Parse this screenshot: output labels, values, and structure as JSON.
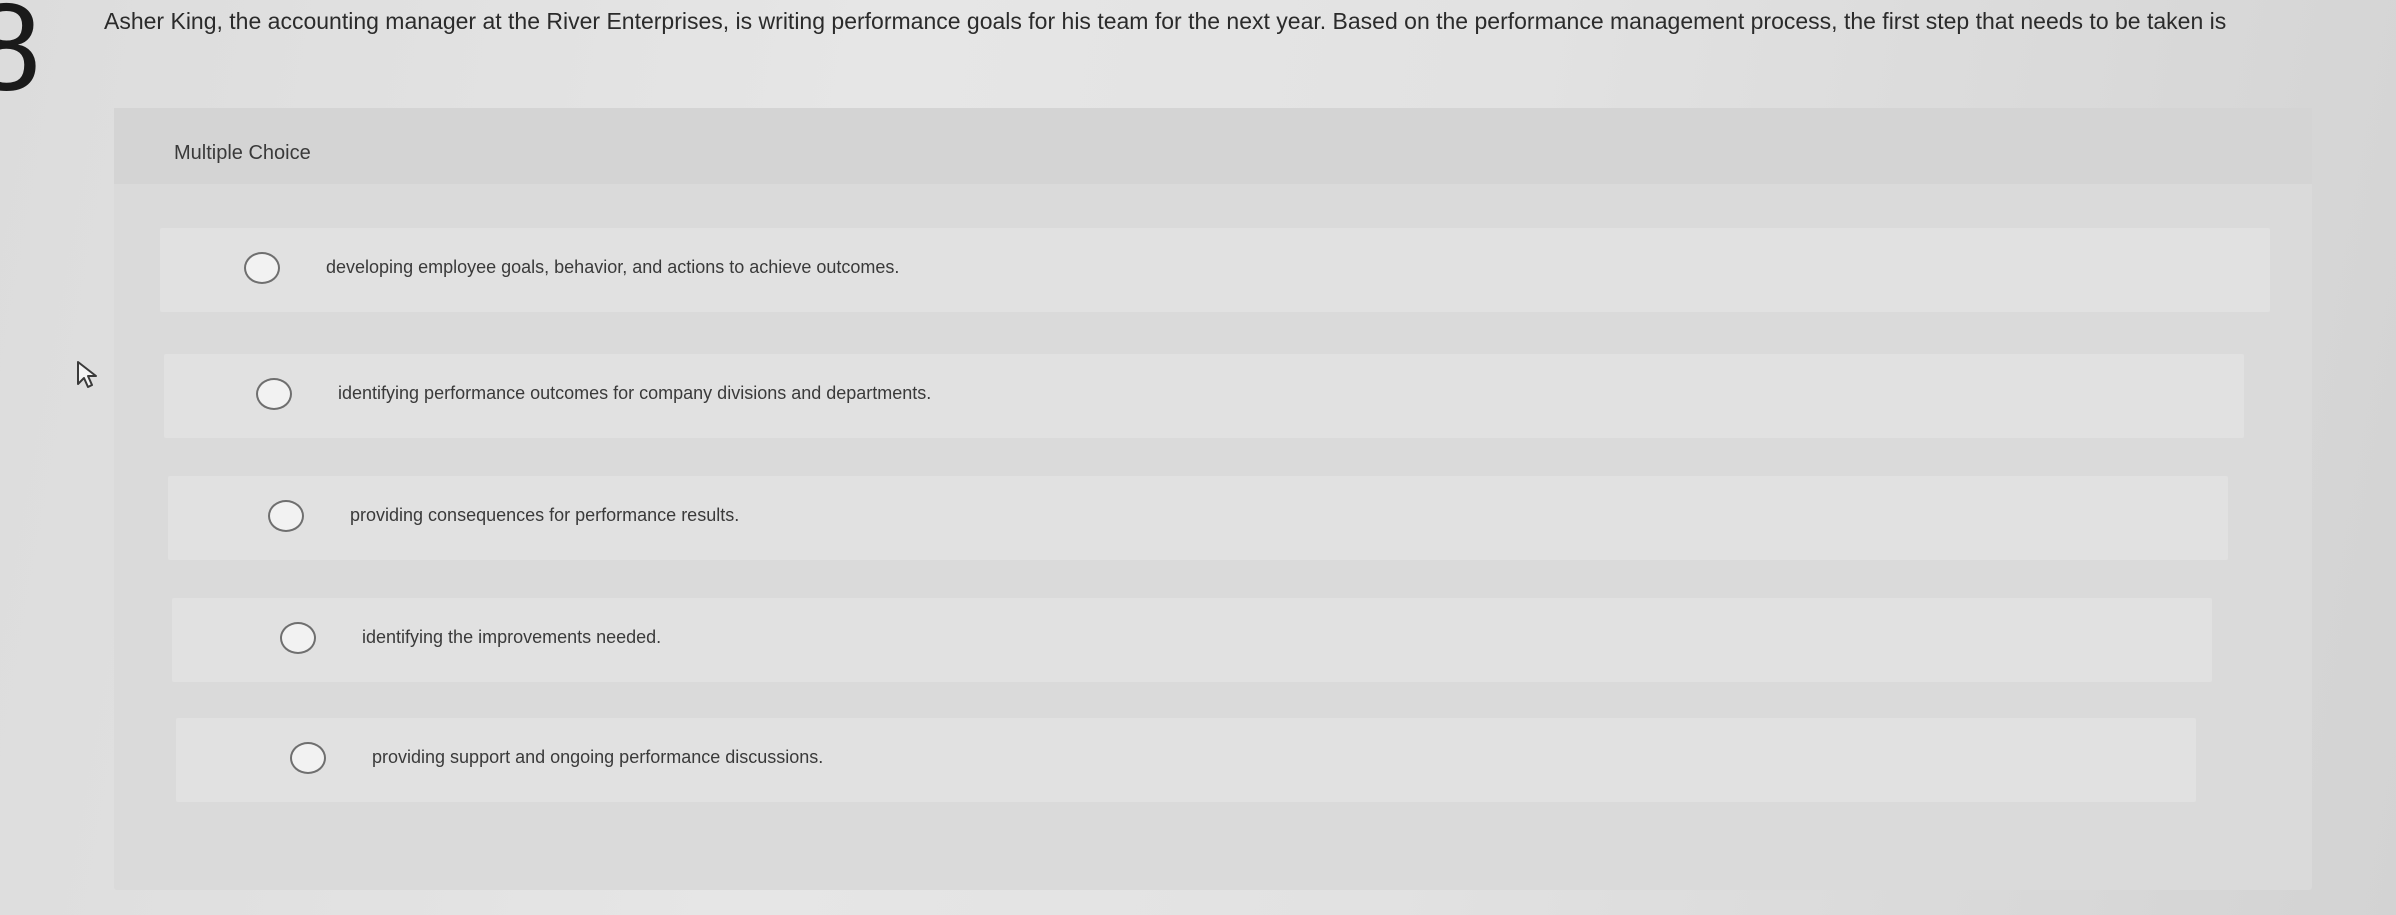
{
  "question": {
    "number": "8",
    "text": "Asher King, the accounting manager at the River Enterprises, is writing performance goals for his team for the next year. Based on the performance management process, the first step that needs to be taken is"
  },
  "answer_panel": {
    "type_label": "Multiple Choice",
    "options": [
      {
        "label": "developing employee goals, behavior, and actions to achieve outcomes.",
        "selected": false
      },
      {
        "label": "identifying performance outcomes for company divisions and departments.",
        "selected": false
      },
      {
        "label": "providing consequences for performance results.",
        "selected": false
      },
      {
        "label": "identifying the improvements needed.",
        "selected": false
      },
      {
        "label": "providing support and ongoing performance discussions.",
        "selected": false
      }
    ]
  },
  "cursor_icon": "mouse-pointer-arrow",
  "colors": {
    "radio_border": "#6f6f6f",
    "text": "#3a3a3a"
  }
}
